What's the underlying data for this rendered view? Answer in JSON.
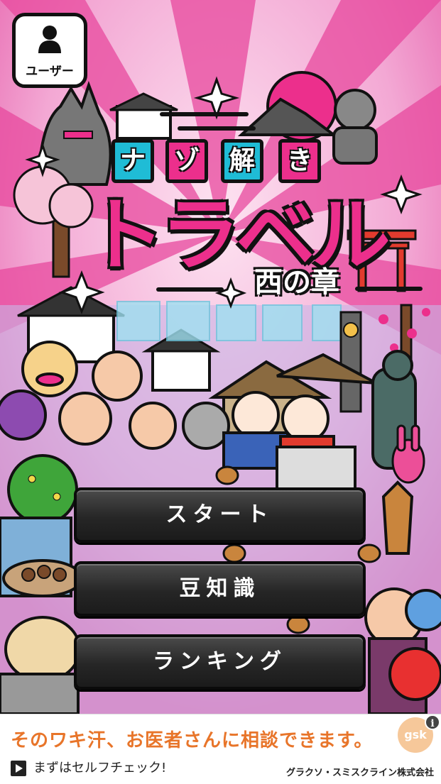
{
  "header": {
    "user_label": "ユーザー"
  },
  "logo": {
    "top_tiles": [
      "ナ",
      "ゾ",
      "解",
      "き"
    ],
    "main": "トラベル",
    "sub": "西の章"
  },
  "menu": {
    "start": "スタート",
    "trivia": "豆知識",
    "ranking": "ランキング"
  },
  "ad": {
    "headline": "そのワキ汗、お医者さんに相談できます。",
    "cta": "まずはセルフチェック!",
    "advertiser": "グラクソ・スミスクライン株式会社",
    "logo_text": "gsk",
    "info_icon": "i"
  },
  "colors": {
    "pink": "#ec2f8c",
    "cyan": "#1fbcd6",
    "button_dark": "#262626",
    "ad_orange": "#e8752a"
  }
}
